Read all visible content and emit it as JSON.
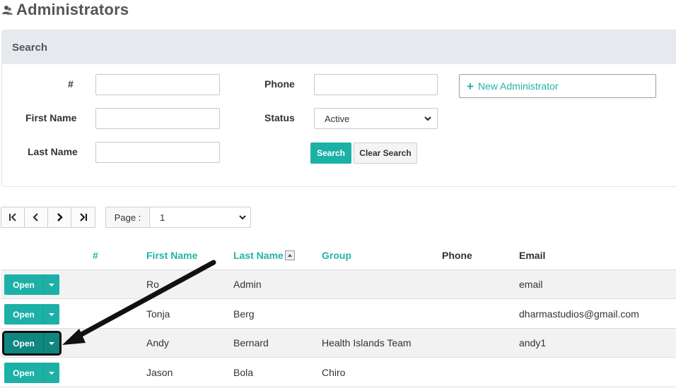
{
  "page": {
    "title": "Administrators",
    "title_icon": "users-icon"
  },
  "search": {
    "heading": "Search",
    "labels": {
      "number": "#",
      "first_name": "First Name",
      "last_name": "Last Name",
      "phone": "Phone",
      "status": "Status"
    },
    "values": {
      "number": "",
      "first_name": "",
      "last_name": "",
      "phone": ""
    },
    "status_selected": "Active",
    "new_admin_label": "New Administrator",
    "search_label": "Search",
    "clear_label": "Clear Search"
  },
  "pager": {
    "page_label": "Page :",
    "page_value": "1"
  },
  "table": {
    "headers": {
      "num": "#",
      "first_name": "First Name",
      "last_name": "Last Name",
      "group": "Group",
      "phone": "Phone",
      "email": "Email"
    },
    "open_label": "Open",
    "rows": [
      {
        "first_name": "Ro",
        "last_name": "Admin",
        "group": "",
        "phone": "",
        "email": "email"
      },
      {
        "first_name": "Tonja",
        "last_name": "Berg",
        "group": "",
        "phone": "",
        "email": "dharmastudios@gmail.com"
      },
      {
        "first_name": "Andy",
        "last_name": "Bernard",
        "group": "Health Islands Team",
        "phone": "",
        "email": "andy1"
      },
      {
        "first_name": "Jason",
        "last_name": "Bola",
        "group": "Chiro",
        "phone": "",
        "email": ""
      }
    ]
  },
  "colors": {
    "accent": "#1cb0a6",
    "accent_dark": "#0f877f",
    "panel_header": "#e6e9ee"
  }
}
